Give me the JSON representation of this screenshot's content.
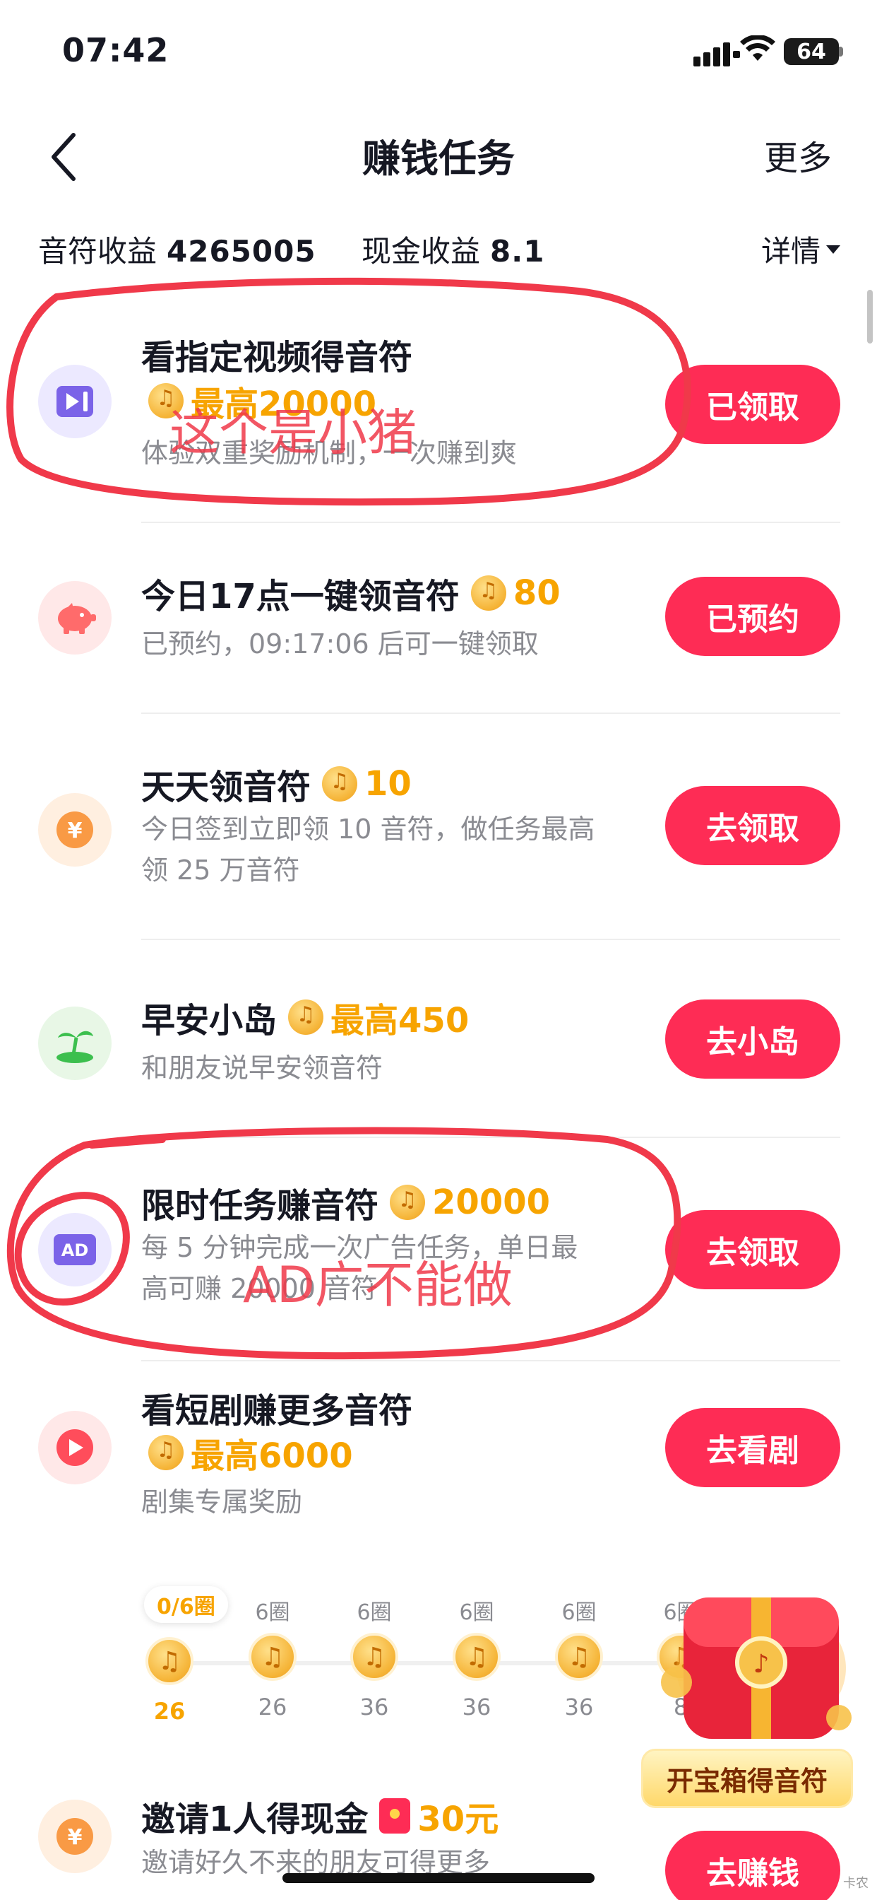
{
  "status_bar": {
    "time": "07:42",
    "battery": "64"
  },
  "nav": {
    "title": "赚钱任务",
    "more": "更多"
  },
  "earnings": {
    "notes_label": "音符收益",
    "notes_value": "4265005",
    "cash_label": "现金收益",
    "cash_value": "8.1",
    "detail": "详情"
  },
  "tasks": [
    {
      "title": "看指定视频得音符",
      "reward": "最高20000",
      "desc": "体验双重奖励机制，一次赚到爽",
      "button": "已领取",
      "icon": "video-play-icon",
      "icon_bg": "#ece9ff",
      "icon_color": "#7b63e8"
    },
    {
      "title": "今日17点一键领音符",
      "reward": "80",
      "desc": "已预约，09:17:06 后可一键领取",
      "button": "已预约",
      "icon": "piggy-bank-icon",
      "icon_bg": "#ffe8e8",
      "icon_color": "#ff6b6b"
    },
    {
      "title": "天天领音符",
      "reward": "10",
      "desc_lines": [
        "今日签到立即领 10 音符，做任务最高",
        "领 25 万音符"
      ],
      "button": "去领取",
      "icon": "yen-coin-icon",
      "icon_bg": "#ffefe0",
      "icon_color": "#f99a45"
    },
    {
      "title": "早安小岛",
      "reward": "最高450",
      "desc": "和朋友说早安领音符",
      "button": "去小岛",
      "icon": "island-icon",
      "icon_bg": "#e8f7e6",
      "icon_color": "#3cbf4e"
    },
    {
      "title": "限时任务赚音符",
      "reward": "20000",
      "desc_lines": [
        "每 5 分钟完成一次广告任务，单日最",
        "高可赚 20000 音符"
      ],
      "button": "去领取",
      "icon": "ad-icon",
      "icon_bg": "#ece9ff",
      "icon_color": "#7b63e8",
      "icon_text": "AD"
    },
    {
      "title": "看短剧赚更多音符",
      "reward": "最高6000",
      "desc": "剧集专属奖励",
      "button": "去看剧",
      "icon": "short-drama-icon",
      "icon_bg": "#ffe8e8",
      "icon_color": "#ff4d5b"
    },
    {
      "title": "邀请1人得现金",
      "reward": "30元",
      "desc": "邀请好久不来的朋友可得更多",
      "button": "去赚钱",
      "icon": "yen-coin-icon",
      "icon_bg": "#ffefe0",
      "icon_color": "#f99a45"
    }
  ],
  "drama_progress": {
    "current": "0/6圈",
    "steps": [
      {
        "label": "",
        "value": "26"
      },
      {
        "label": "6圈",
        "value": "26"
      },
      {
        "label": "6圈",
        "value": "36"
      },
      {
        "label": "6圈",
        "value": "36"
      },
      {
        "label": "6圈",
        "value": "36"
      },
      {
        "label": "6圈",
        "value": "8"
      }
    ]
  },
  "treasure": {
    "label": "开宝箱得音符"
  },
  "annotations": {
    "note1": "这个是小猪",
    "note2": "AD广不能做"
  },
  "watermark": "卡农",
  "colors": {
    "accent": "#fe2c55",
    "reward": "#f7a400",
    "annotation": "#f0394a"
  }
}
